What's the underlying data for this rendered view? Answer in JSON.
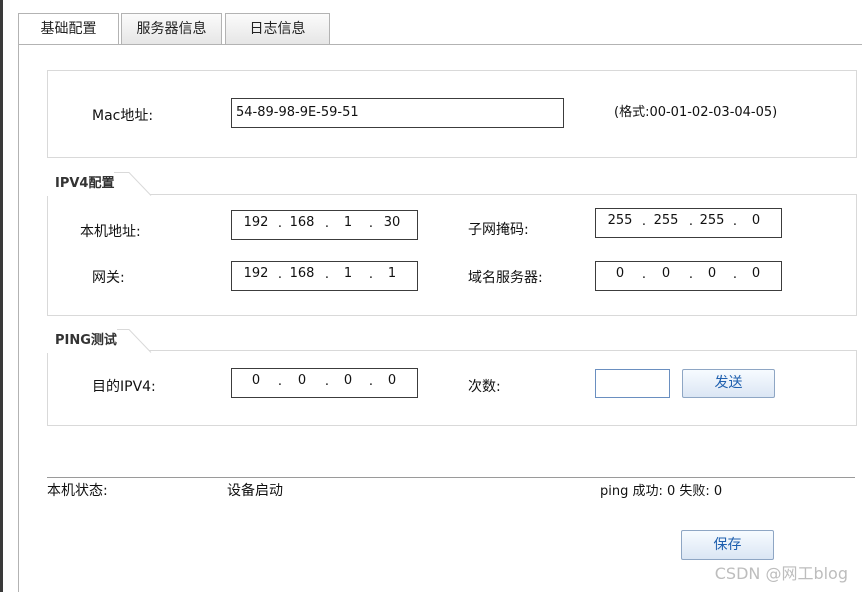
{
  "tabs": [
    {
      "label": "基础配置",
      "active": true
    },
    {
      "label": "服务器信息",
      "active": false
    },
    {
      "label": "日志信息",
      "active": false
    }
  ],
  "mac": {
    "label": "Mac地址:",
    "value": "54-89-98-9E-59-51",
    "hint": "(格式:00-01-02-03-04-05)"
  },
  "ipv4": {
    "legend": "IPV4配置",
    "local_label": "本机地址:",
    "local": [
      "192",
      "168",
      "1",
      "30"
    ],
    "subnet_label": "子网掩码:",
    "subnet": [
      "255",
      "255",
      "255",
      "0"
    ],
    "gateway_label": "网关:",
    "gateway": [
      "192",
      "168",
      "1",
      "1"
    ],
    "dns_label": "域名服务器:",
    "dns": [
      "0",
      "0",
      "0",
      "0"
    ]
  },
  "ping": {
    "legend": "PING测试",
    "target_label": "目的IPV4:",
    "target": [
      "0",
      "0",
      "0",
      "0"
    ],
    "count_label": "次数:",
    "count_value": "",
    "send_label": "发送"
  },
  "status": {
    "label": "本机状态:",
    "value": "设备启动",
    "ping_result": "ping 成功: 0 失败: 0"
  },
  "save_label": "保存",
  "watermark": "CSDN @网工blog",
  "colors": {
    "border": "#b3b3b3",
    "panel_border": "#d9d9d9",
    "button_text": "#1e5fae"
  }
}
